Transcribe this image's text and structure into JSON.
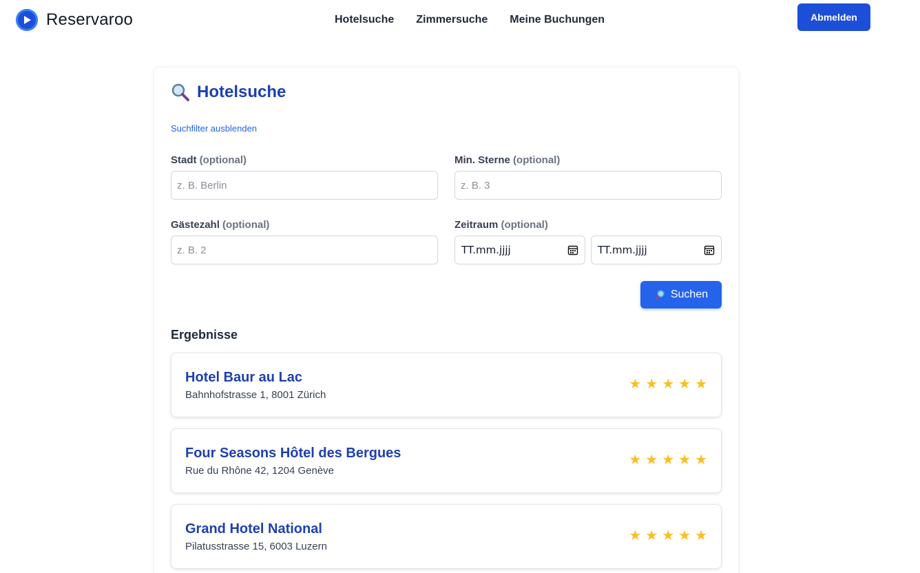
{
  "app": {
    "name": "Reservaroo"
  },
  "nav": {
    "items": [
      "Hotelsuche",
      "Zimmersuche",
      "Meine Buchungen"
    ],
    "logout_label": "Abmelden"
  },
  "page": {
    "title": "Hotelsuche",
    "toggle_filter": "Suchfilter ausblenden"
  },
  "filters": {
    "optional_hint": "(optional)",
    "city": {
      "label": "Stadt",
      "placeholder": "z. B. Berlin",
      "value": ""
    },
    "min_stars": {
      "label": "Min. Sterne",
      "placeholder": "z. B. 3",
      "value": ""
    },
    "guests": {
      "label": "Gästezahl",
      "placeholder": "z. B. 2",
      "value": ""
    },
    "period": {
      "label": "Zeitraum",
      "from": "TT.mm.jjjj",
      "to": "TT.mm.jjjj"
    }
  },
  "search_button": "Suchen",
  "results": {
    "title": "Ergebnisse",
    "items": [
      {
        "name": "Hotel Baur au Lac",
        "address": "Bahnhofstrasse 1, 8001 Zürich",
        "stars": 5
      },
      {
        "name": "Four Seasons Hôtel des Bergues",
        "address": "Rue du Rhône 42, 1204 Genève",
        "stars": 5
      },
      {
        "name": "Grand Hotel National",
        "address": "Pilatusstrasse 15, 6003 Luzern",
        "stars": 5
      }
    ]
  },
  "colors": {
    "accent": "#2563eb",
    "brand": "#1d4ed8",
    "title": "#1e40af",
    "star": "#fbbf24"
  }
}
